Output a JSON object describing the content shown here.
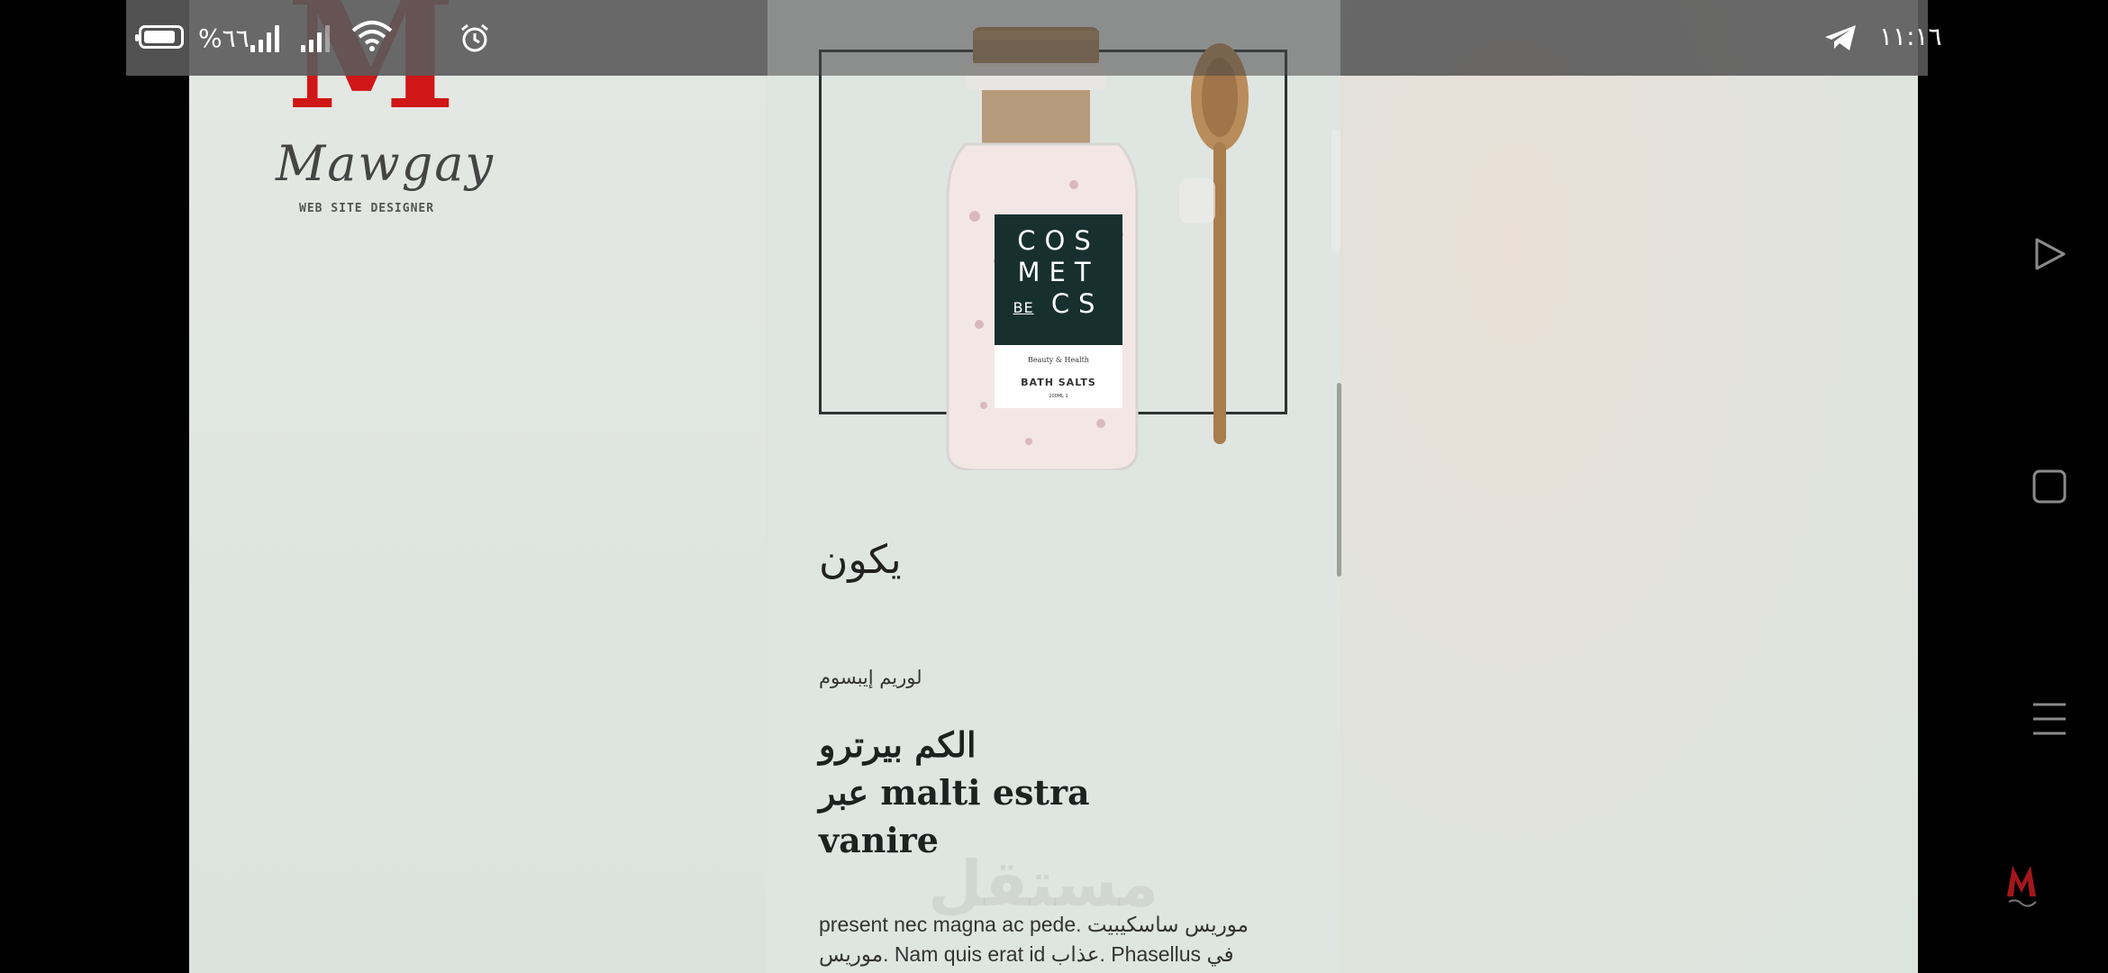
{
  "status_bar": {
    "time": "١١:١٦",
    "battery": "%٦٦",
    "icons": [
      "battery-icon",
      "signal-icon",
      "signal-icon",
      "wifi-icon",
      "alarm-icon",
      "telegram-icon"
    ]
  },
  "logo": {
    "letter": "M",
    "script": "Mawgay",
    "subtitle": "WEB SITE DESIGNER"
  },
  "product": {
    "label_top": "COS",
    "label_mid": "MET",
    "label_be": "BE",
    "label_bottom": "CS",
    "label_small": "Beauty & Health",
    "label_name": "BATH SALTS",
    "label_weight": "200ML 1"
  },
  "content": {
    "heading": "يكون",
    "eyebrow": "لوريم إيبسوم",
    "title_line1": "الكم بيرترو",
    "title_line2": "عبر malti estra",
    "title_line3": "vanire",
    "body_line1": "present nec magna ac pede. موريس ساسكيبيت",
    "body_line2": "موريس. Nam quis erat id عذاب. Phasellus في"
  },
  "watermark": "مستقل",
  "nav": {
    "icons": [
      "play-icon",
      "recent-apps-icon",
      "menu-icon"
    ]
  }
}
